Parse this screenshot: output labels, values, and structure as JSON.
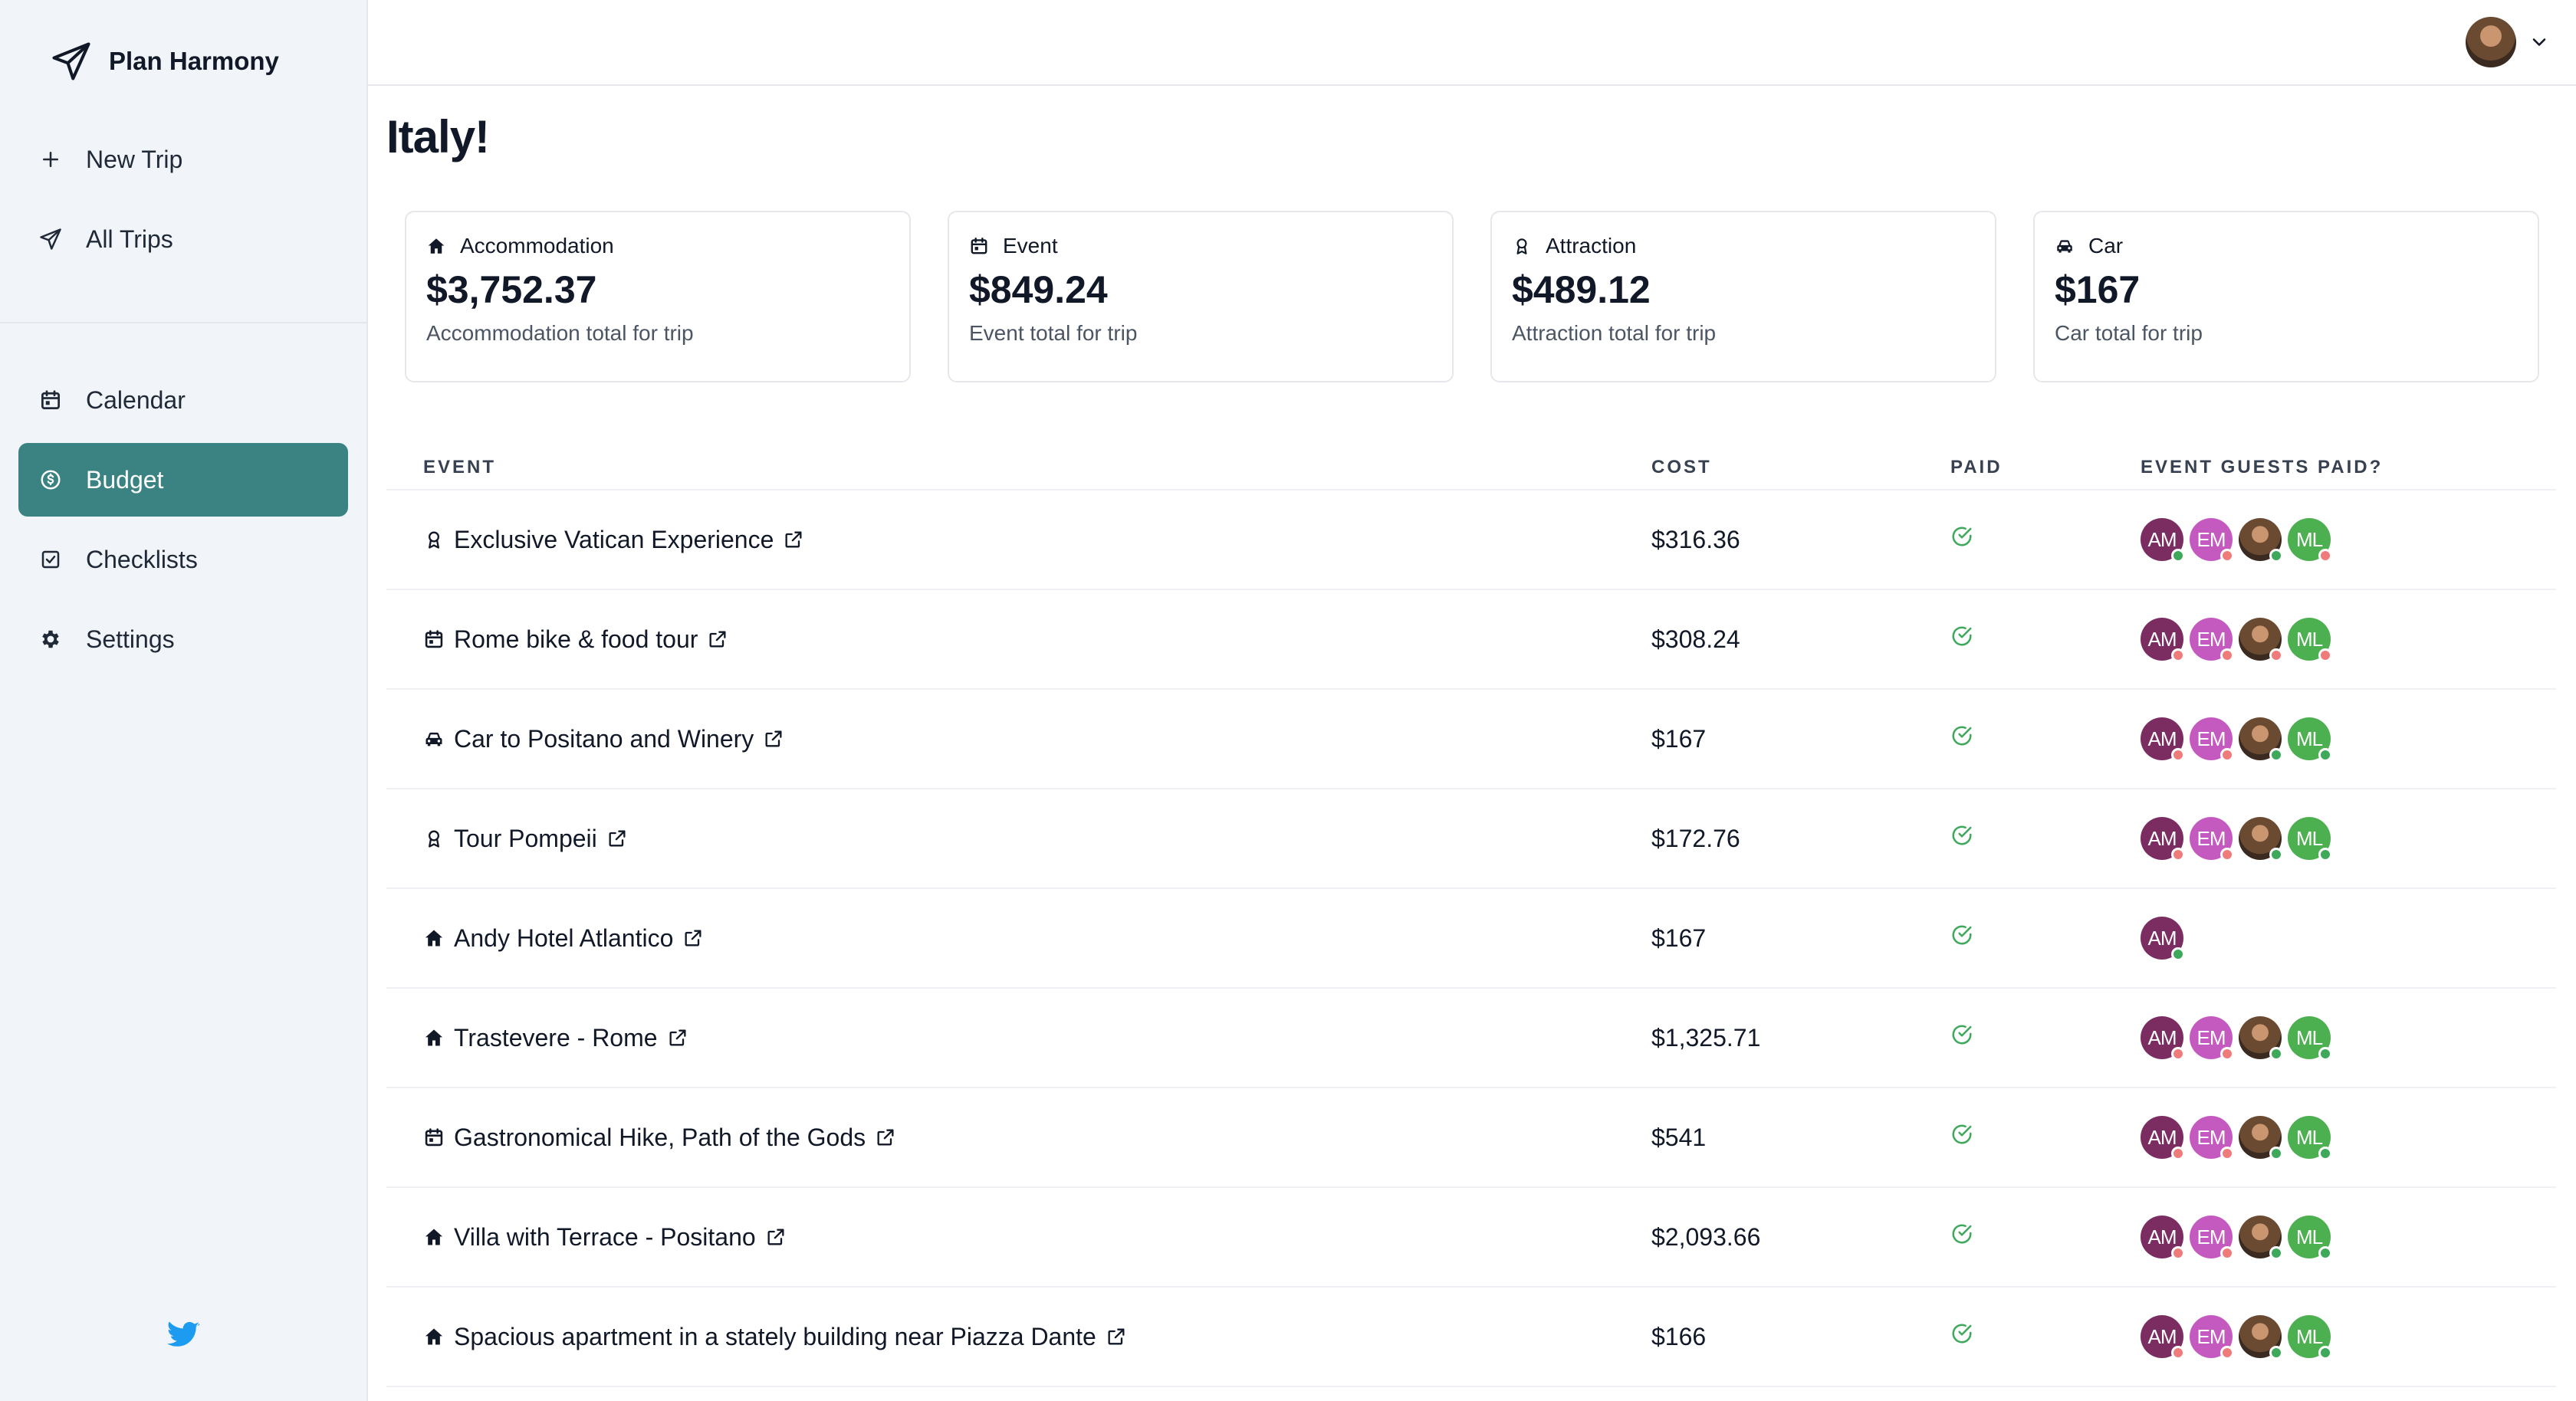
{
  "brand": {
    "name": "Plan Harmony"
  },
  "nav_top": [
    {
      "label": "New Trip",
      "icon": "plus-icon"
    },
    {
      "label": "All Trips",
      "icon": "paper-plane-icon"
    }
  ],
  "nav_main": [
    {
      "label": "Calendar",
      "icon": "calendar-icon",
      "active": false
    },
    {
      "label": "Budget",
      "icon": "dollar-circle-icon",
      "active": true
    },
    {
      "label": "Checklists",
      "icon": "checkbox-icon",
      "active": false
    },
    {
      "label": "Settings",
      "icon": "gear-icon",
      "active": false
    }
  ],
  "page": {
    "title": "Italy!"
  },
  "cards": [
    {
      "title": "Accommodation",
      "icon": "house-icon",
      "amount": "$3,752.37",
      "desc": "Accommodation total for trip"
    },
    {
      "title": "Event",
      "icon": "calendar-icon",
      "amount": "$849.24",
      "desc": "Event total for trip"
    },
    {
      "title": "Attraction",
      "icon": "award-icon",
      "amount": "$489.12",
      "desc": "Attraction total for trip"
    },
    {
      "title": "Car",
      "icon": "car-icon",
      "amount": "$167",
      "desc": "Car total for trip"
    }
  ],
  "table": {
    "headers": {
      "event": "EVENT",
      "cost": "COST",
      "paid": "PAID",
      "guests": "EVENT GUESTS PAID?"
    },
    "rows": [
      {
        "name": "Exclusive Vatican Experience",
        "type": "award-icon",
        "cost": "$316.36",
        "paid": true,
        "guests": [
          {
            "i": "AM",
            "s": "paid"
          },
          {
            "i": "EM",
            "s": "unpaid"
          },
          {
            "i": "",
            "s": "paid",
            "photo": true
          },
          {
            "i": "ML",
            "s": "unpaid"
          }
        ]
      },
      {
        "name": "Rome bike & food tour",
        "type": "calendar-icon",
        "cost": "$308.24",
        "paid": true,
        "guests": [
          {
            "i": "AM",
            "s": "unpaid"
          },
          {
            "i": "EM",
            "s": "unpaid"
          },
          {
            "i": "",
            "s": "unpaid",
            "photo": true
          },
          {
            "i": "ML",
            "s": "unpaid"
          }
        ]
      },
      {
        "name": "Car to Positano and Winery",
        "type": "car-icon",
        "cost": "$167",
        "paid": true,
        "guests": [
          {
            "i": "AM",
            "s": "unpaid"
          },
          {
            "i": "EM",
            "s": "unpaid"
          },
          {
            "i": "",
            "s": "paid",
            "photo": true
          },
          {
            "i": "ML",
            "s": "paid"
          }
        ]
      },
      {
        "name": "Tour Pompeii",
        "type": "award-icon",
        "cost": "$172.76",
        "paid": true,
        "guests": [
          {
            "i": "AM",
            "s": "unpaid"
          },
          {
            "i": "EM",
            "s": "unpaid"
          },
          {
            "i": "",
            "s": "paid",
            "photo": true
          },
          {
            "i": "ML",
            "s": "paid"
          }
        ]
      },
      {
        "name": "Andy Hotel Atlantico",
        "type": "house-icon",
        "cost": "$167",
        "paid": true,
        "guests": [
          {
            "i": "AM",
            "s": "paid"
          }
        ]
      },
      {
        "name": "Trastevere - Rome",
        "type": "house-icon",
        "cost": "$1,325.71",
        "paid": true,
        "guests": [
          {
            "i": "AM",
            "s": "unpaid"
          },
          {
            "i": "EM",
            "s": "unpaid"
          },
          {
            "i": "",
            "s": "paid",
            "photo": true
          },
          {
            "i": "ML",
            "s": "paid"
          }
        ]
      },
      {
        "name": "Gastronomical Hike, Path of the Gods",
        "type": "calendar-icon",
        "cost": "$541",
        "paid": true,
        "guests": [
          {
            "i": "AM",
            "s": "unpaid"
          },
          {
            "i": "EM",
            "s": "unpaid"
          },
          {
            "i": "",
            "s": "paid",
            "photo": true
          },
          {
            "i": "ML",
            "s": "paid"
          }
        ]
      },
      {
        "name": "Villa with Terrace - Positano",
        "type": "house-icon",
        "cost": "$2,093.66",
        "paid": true,
        "guests": [
          {
            "i": "AM",
            "s": "unpaid"
          },
          {
            "i": "EM",
            "s": "unpaid"
          },
          {
            "i": "",
            "s": "paid",
            "photo": true
          },
          {
            "i": "ML",
            "s": "paid"
          }
        ]
      },
      {
        "name": "Spacious apartment in a stately building near Piazza Dante",
        "type": "house-icon",
        "cost": "$166",
        "paid": true,
        "guests": [
          {
            "i": "AM",
            "s": "unpaid"
          },
          {
            "i": "EM",
            "s": "unpaid"
          },
          {
            "i": "",
            "s": "paid",
            "photo": true
          },
          {
            "i": "ML",
            "s": "paid"
          }
        ]
      }
    ]
  },
  "colors": {
    "accent": "#3b8383",
    "avatar_AM": "#7b2d62",
    "avatar_EM": "#c45ac0",
    "avatar_ML": "#4caf50",
    "status_paid": "#3ea85b",
    "status_unpaid": "#f07b7b",
    "check": "#3ea85b",
    "twitter": "#1d9bf0"
  }
}
